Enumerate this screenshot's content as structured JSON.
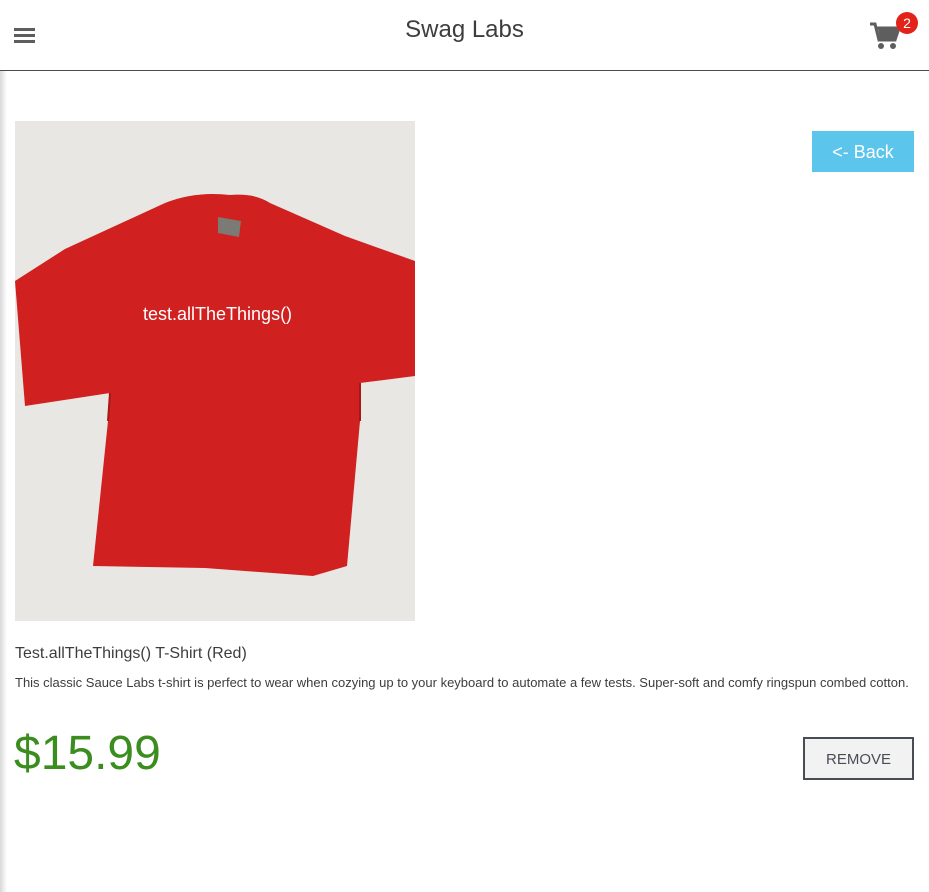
{
  "header": {
    "title": "Swag Labs",
    "menu_icon": "hamburger-menu-icon",
    "cart_icon": "shopping-cart-icon",
    "cart_count": "2"
  },
  "product": {
    "image_text": "test.allTheThings()",
    "name": "Test.allTheThings() T-Shirt (Red)",
    "description": "This classic Sauce Labs t-shirt is perfect to wear when cozying up to your keyboard to automate a few tests. Super-soft and comfy ringspun combed cotton.",
    "price": "$15.99",
    "remove_label": "REMOVE",
    "back_label": "<- Back"
  },
  "colors": {
    "accent": "#5bc5ec",
    "price": "#3c8d1f",
    "badge": "#e2231a",
    "shirt": "#d0201f"
  }
}
